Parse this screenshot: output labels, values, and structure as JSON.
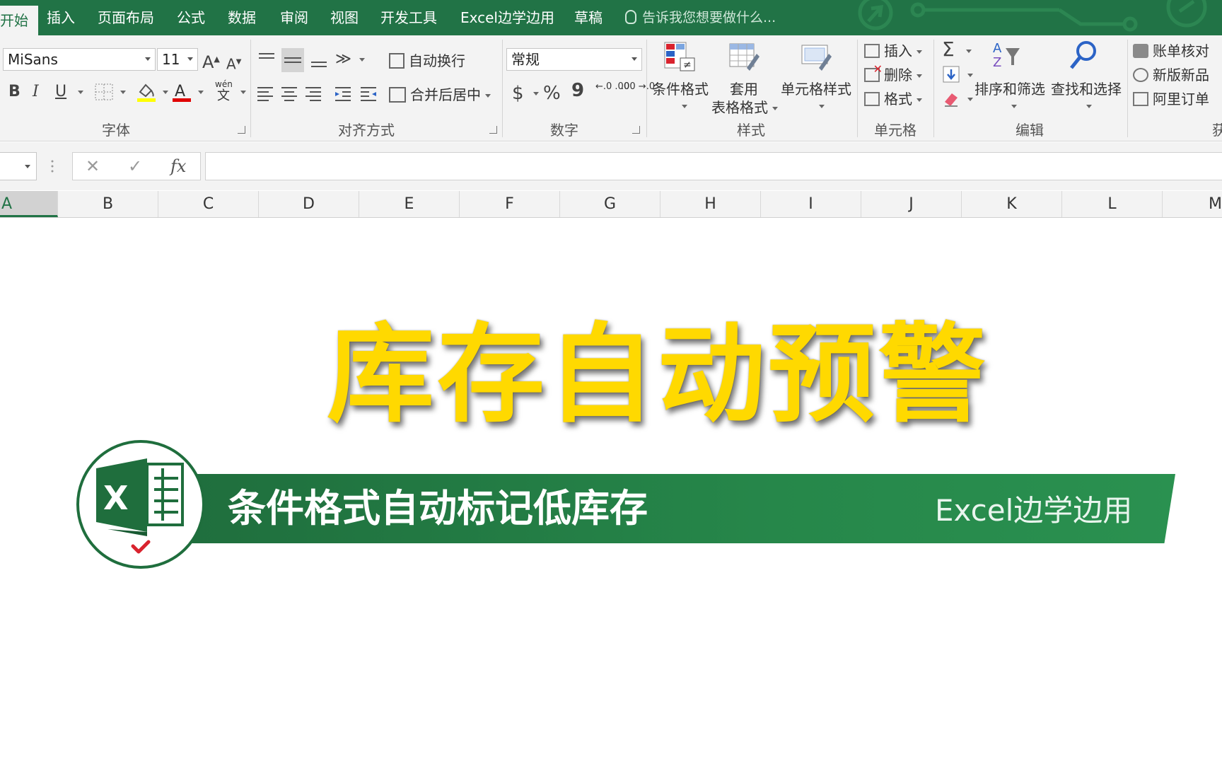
{
  "menu": {
    "tabs": [
      {
        "label": "开始",
        "active": true
      },
      {
        "label": "插入"
      },
      {
        "label": "页面布局"
      },
      {
        "label": "公式"
      },
      {
        "label": "数据"
      },
      {
        "label": "审阅"
      },
      {
        "label": "视图"
      },
      {
        "label": "开发工具"
      },
      {
        "label": "Excel边学边用"
      },
      {
        "label": "草稿"
      }
    ],
    "tell_me": "告诉我您想要做什么..."
  },
  "ribbon": {
    "font": {
      "name": "MiSans",
      "size": "11",
      "grow": "A",
      "shrink": "A",
      "bold": "B",
      "italic": "I",
      "underline": "U",
      "phonetic_top": "wén",
      "phonetic_bottom": "文",
      "label": "字体"
    },
    "alignment": {
      "wrap_text": "自动换行",
      "merge_center": "合并后居中",
      "label": "对齐方式"
    },
    "number": {
      "format": "常规",
      "currency": "$",
      "percent": "%",
      "comma": "9",
      "increase_decimal": "←.0 .00",
      "decrease_decimal": ".00 →.0",
      "label": "数字"
    },
    "styles": {
      "conditional_format": "条件格式",
      "table_format_line1": "套用",
      "table_format_line2": "表格格式",
      "cell_styles": "单元格样式",
      "label": "样式"
    },
    "cells": {
      "insert": "插入",
      "delete": "删除",
      "format": "格式",
      "label": "单元格"
    },
    "editing": {
      "sum": "Σ",
      "sort_filter": "排序和筛选",
      "find_select": "查找和选择",
      "label": "编辑"
    },
    "addins": {
      "account_check": "账单核对",
      "new_products": "新版新品",
      "ali_orders": "阿里订单",
      "label_partial": "获"
    }
  },
  "formula_bar": {
    "cancel": "✕",
    "enter": "✓",
    "fx": "fx"
  },
  "columns": [
    "A",
    "B",
    "C",
    "D",
    "E",
    "F",
    "G",
    "H",
    "I",
    "J",
    "K",
    "L",
    "M"
  ],
  "selected_column": "A",
  "content": {
    "headline": "库存自动预警",
    "subtitle": "条件格式自动标记低库存",
    "brand": "Excel边学边用",
    "logo_letter": "X"
  },
  "colors": {
    "excel_green": "#217346",
    "headline_yellow": "#ffd900",
    "banner_green": "#26874a",
    "check_red": "#d9232e"
  }
}
